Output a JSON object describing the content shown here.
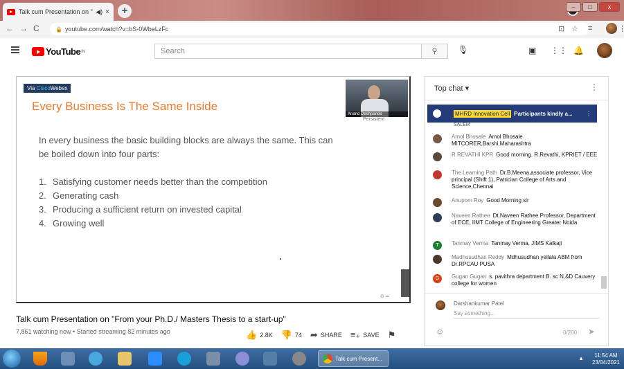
{
  "browser": {
    "tab_title": "Talk cum Presentation on \"Fr",
    "tab_close": "×",
    "new_tab": "+",
    "url": "youtube.com/watch?v=bS-0WbeLzFc"
  },
  "youtube": {
    "logo_text": "YouTube",
    "region": "IN",
    "search_placeholder": "Search"
  },
  "slide": {
    "badge_prefix": "Via ",
    "badge_brand": "Cisco",
    "badge_suffix": "Webex",
    "title": "Every Business Is The Same Inside",
    "intro": "In every business the basic building blocks are always the same. This can be boiled down into four parts:",
    "items": [
      {
        "num": "1.",
        "text": "Satisfying customer needs better than the competition"
      },
      {
        "num": "2.",
        "text": "Generating cash"
      },
      {
        "num": "3.",
        "text": "Producing a sufficient return on invested capital"
      },
      {
        "num": "4.",
        "text": "Growing well"
      }
    ],
    "presenter": "Anand Deshpande",
    "presenter_sub": "Persistent"
  },
  "video": {
    "title": "Talk cum Presentation on \"From your Ph.D./ Masters Thesis to a start-up\"",
    "meta": "7,861 watching now • Started streaming 82 minutes ago",
    "likes": "2.8K",
    "dislikes": "74",
    "share": "SHARE",
    "save": "SAVE"
  },
  "chat": {
    "header": "Top chat",
    "pinned_author": "MHRD Innovation Cell",
    "pinned_message": "Participants kindly a...",
    "partial_text": "SALEM",
    "messages": [
      {
        "author": "Amol Bhosale",
        "text": "Amol Bhosale MITCORER,Barshi,Maharashtra",
        "color": "#7a5a44"
      },
      {
        "author": "R REVATHI KPR",
        "text": "Good morning. R.Revathi, KPRIET / EEE",
        "color": "#5a4a3a"
      },
      {
        "author": "The Learning Path",
        "text": "Dr.B.Meena,associate professor, Vice principal (Shift 1), Patrician College of Arts and Science,Chennai",
        "color": "#c0392b"
      },
      {
        "author": "Anupom Roy",
        "text": "Good Morning sir",
        "color": "#6b4a2e"
      },
      {
        "author": "Naveen Rathee",
        "text": "Dt.Naveen Rathee Professor, Department of ECE, IIMT College of Engineering Greater Noida",
        "color": "#2f3f5a"
      },
      {
        "author": "Tanmay Verma",
        "text": "Tanmay Verma, JIMS Kalkaji",
        "color": "#1e7e34",
        "initial": "T"
      },
      {
        "author": "Madhusudhan Reddy",
        "text": "Mdhusudhan yellala ABM from Dr.RPCAU PUSA",
        "color": "#4a3a2a"
      },
      {
        "author": "Gugan Gugan",
        "text": "s. pavithra department B. sc N,&D Cauvery college for women",
        "color": "#d84315",
        "initial": "G"
      }
    ],
    "user_name": "Darshankumar Patel",
    "input_placeholder": "Say something...",
    "char_count": "0/200"
  },
  "taskbar": {
    "active_window": "Talk cum Present...",
    "time": "11:54 AM",
    "date": "23/04/2021"
  }
}
